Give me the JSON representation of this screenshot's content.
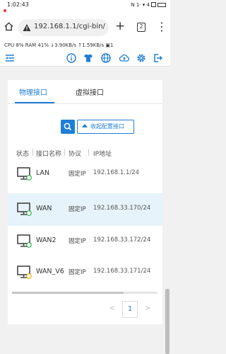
{
  "status_bar": {
    "time": "1:02:43",
    "right_text": "N 1⋅ ▾ 4"
  },
  "browser": {
    "url": "192.168.1.1/cgi-bin/",
    "tab_count": "2"
  },
  "system_info": "CPU 8%  RAM 41%  ↓3.90KB/s  ↑1.59KB/s  ▣1",
  "tabs": [
    {
      "label": "物理接口",
      "active": true
    },
    {
      "label": "虚拟接口",
      "active": false
    }
  ],
  "controls": {
    "collapse_label": "收起配置接口"
  },
  "columns": [
    "状态",
    "接口名称",
    "协议",
    "IP地址"
  ],
  "rows": [
    {
      "name": "LAN",
      "protocol": "固定IP",
      "ip": "192.168.1.1/24",
      "selected": false,
      "status_color": "#2fb34a"
    },
    {
      "name": "WAN",
      "protocol": "固定IP",
      "ip": "192.168.33.170/24",
      "selected": true,
      "status_color": "#2fb34a"
    },
    {
      "name": "WAN2",
      "protocol": "固定IP",
      "ip": "192.168.33.172/24",
      "selected": false,
      "status_color": "#2fb34a"
    },
    {
      "name": "WAN_V6",
      "protocol": "固定IP",
      "ip": "192.168.33.171/24",
      "selected": false,
      "status_color": "#f3b100"
    }
  ],
  "pagination": {
    "prev": "<",
    "current": "1",
    "next": ">"
  },
  "colors": {
    "accent": "#1f7ed6",
    "selected_row": "#e6f3fb",
    "status_ok": "#2fb34a",
    "status_warn": "#f3b100"
  }
}
